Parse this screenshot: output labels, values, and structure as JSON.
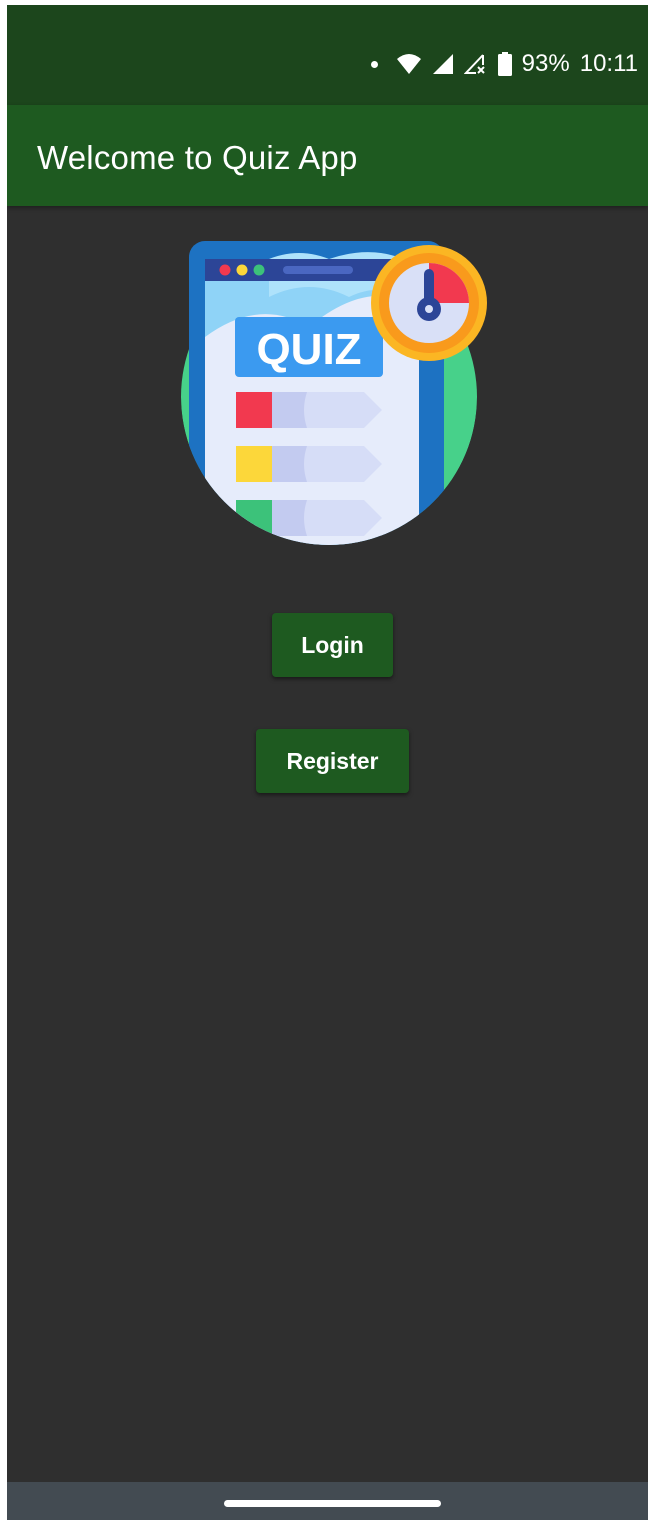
{
  "status_bar": {
    "battery_percent": "93%",
    "time": "10:11",
    "icons": [
      "dot-icon",
      "wifi-icon",
      "signal-icon",
      "signal-off-icon",
      "battery-icon"
    ]
  },
  "app_bar": {
    "title": "Welcome to Quiz App"
  },
  "illustration": {
    "label": "QUIZ",
    "colors": {
      "circle": "#47d18a",
      "frame": "#1d72c2",
      "screen": "#e6ecfb",
      "red": "#f2394f",
      "yellow": "#fcd73a",
      "green": "#3cc27a",
      "timer_ring": "#fbb623"
    }
  },
  "buttons": {
    "login": "Login",
    "register": "Register"
  },
  "colors": {
    "status_bar": "#1c461c",
    "app_bar": "#1e5a20",
    "background": "#2f2f2f",
    "button": "#1e5a20",
    "nav_bar": "#434b52"
  }
}
